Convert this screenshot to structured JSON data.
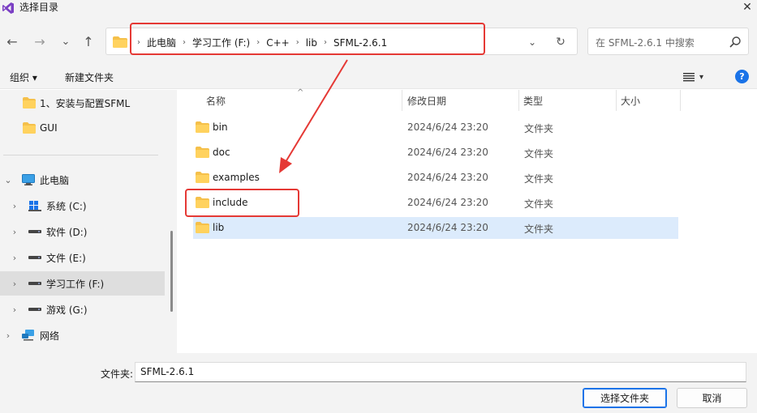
{
  "window": {
    "title": "选择目录",
    "close_glyph": "✕"
  },
  "nav": {
    "back_glyph": "←",
    "forward_glyph": "→",
    "recent_glyph": "⌄",
    "up_glyph": "↑",
    "breadcrumbs": [
      "此电脑",
      "学习工作 (F:)",
      "C++",
      "lib",
      "SFML-2.6.1"
    ],
    "crumb_sep": "›",
    "dropdown_glyph": "⌄",
    "refresh_glyph": "↻",
    "search_placeholder": "在 SFML-2.6.1 中搜索"
  },
  "toolbar": {
    "organize": "组织 ▾",
    "new_folder": "新建文件夹",
    "view_caret": "▾",
    "help": "?"
  },
  "sidebar": {
    "items": [
      {
        "label": "1、安装与配置SFML",
        "icon": "folder-icon",
        "chevron": ""
      },
      {
        "label": "GUI",
        "icon": "folder-icon",
        "chevron": ""
      },
      {
        "label": "此电脑",
        "icon": "computer-icon",
        "chevron": "⌄"
      },
      {
        "label": "系统 (C:)",
        "icon": "windows-drive-icon",
        "chevron": "›"
      },
      {
        "label": "软件 (D:)",
        "icon": "drive-icon",
        "chevron": "›"
      },
      {
        "label": "文件 (E:)",
        "icon": "drive-icon",
        "chevron": "›"
      },
      {
        "label": "学习工作 (F:)",
        "icon": "drive-icon",
        "chevron": "›"
      },
      {
        "label": "游戏 (G:)",
        "icon": "drive-icon",
        "chevron": "›"
      },
      {
        "label": "网络",
        "icon": "network-icon",
        "chevron": "›"
      }
    ],
    "selected": "学习工作 (F:)"
  },
  "list": {
    "columns": [
      "名称",
      "修改日期",
      "类型",
      "大小"
    ],
    "sort_glyph": "^",
    "rows": [
      {
        "name": "bin",
        "date": "2024/6/24 23:20",
        "type": "文件夹"
      },
      {
        "name": "doc",
        "date": "2024/6/24 23:20",
        "type": "文件夹"
      },
      {
        "name": "examples",
        "date": "2024/6/24 23:20",
        "type": "文件夹"
      },
      {
        "name": "include",
        "date": "2024/6/24 23:20",
        "type": "文件夹"
      },
      {
        "name": "lib",
        "date": "2024/6/24 23:20",
        "type": "文件夹"
      }
    ],
    "selected_row": "lib"
  },
  "footer": {
    "folder_label": "文件夹:",
    "folder_value": "SFML-2.6.1",
    "select_button": "选择文件夹",
    "cancel_button": "取消"
  },
  "colors": {
    "accent": "#1a73e8",
    "annotation_red": "#e53935",
    "folder_yellow": "#f5c04a",
    "selection": "#dcebfc"
  }
}
